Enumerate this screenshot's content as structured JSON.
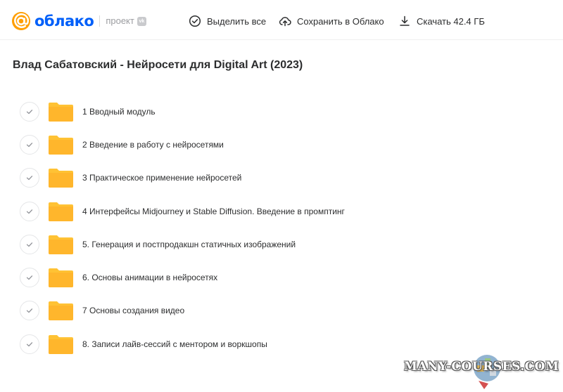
{
  "brand": {
    "name": "облако",
    "project_label": "проект",
    "vk_badge": "vk",
    "color": "#005ff9",
    "at_color": "#ff9e00"
  },
  "toolbar": {
    "select_all": {
      "label": "Выделить все",
      "icon": "check-circle-icon"
    },
    "save_to_cloud": {
      "label": "Сохранить в Облако",
      "icon": "cloud-upload-icon"
    },
    "download": {
      "label": "Скачать 42.4 ГБ",
      "icon": "download-icon"
    }
  },
  "page": {
    "title": "Влад Сабатовский - Нейросети для Digital Art (2023)"
  },
  "folders": [
    {
      "name": "1 Вводный модуль"
    },
    {
      "name": "2 Введение в работу с нейросетями"
    },
    {
      "name": "3 Практическое применение нейросетей"
    },
    {
      "name": "4 Интерфейсы Midjourney и Stable Diffusion. Введение в промптинг"
    },
    {
      "name": "5. Генерация и постпродакшн статичных изображений"
    },
    {
      "name": "6. Основы анимации в нейросетях"
    },
    {
      "name": "7 Основы создания видео"
    },
    {
      "name": "8. Записи лайв-сессий с ментором и воркшопы"
    }
  ],
  "folder_color": "#ffc234",
  "watermark": {
    "text": "MANY-COURSES.COM"
  }
}
